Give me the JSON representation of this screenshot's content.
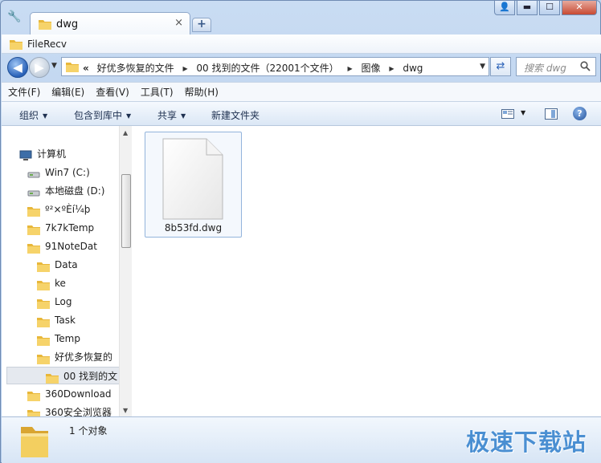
{
  "window": {
    "tab_title": "dwg",
    "tab_close": "×",
    "new_tab": "+",
    "controls": {
      "user": "👤",
      "minimize": "▬",
      "maximize": "☐",
      "close": "✕"
    }
  },
  "favorites": {
    "label": "FileRecv"
  },
  "nav": {
    "back": "◀",
    "forward": "▶",
    "breadcrumbs": [
      "好优多恢复的文件",
      "00 找到的文件（22001个文件）",
      "图像",
      "dwg"
    ],
    "search_placeholder": "搜索 dwg"
  },
  "menu": [
    "文件(F)",
    "编辑(E)",
    "查看(V)",
    "工具(T)",
    "帮助(H)"
  ],
  "commands": {
    "organize": "组织",
    "include_in_library": "包含到库中",
    "share": "共享",
    "new_folder": "新建文件夹",
    "help": "?"
  },
  "tree": [
    {
      "label": "计算机",
      "indent": 0,
      "icon": "computer-icon"
    },
    {
      "label": "Win7 (C:)",
      "indent": 1,
      "icon": "drive-icon"
    },
    {
      "label": "本地磁盘 (D:)",
      "indent": 1,
      "icon": "drive-icon"
    },
    {
      "label": "º²×ºÈí¼þ",
      "indent": 2,
      "icon": "folder-icon"
    },
    {
      "label": "7k7kTemp",
      "indent": 2,
      "icon": "folder-icon"
    },
    {
      "label": "91NoteDat",
      "indent": 2,
      "icon": "folder-icon"
    },
    {
      "label": "Data",
      "indent": 3,
      "icon": "folder-icon"
    },
    {
      "label": "ke",
      "indent": 3,
      "icon": "folder-icon"
    },
    {
      "label": "Log",
      "indent": 3,
      "icon": "folder-icon"
    },
    {
      "label": "Task",
      "indent": 3,
      "icon": "folder-icon"
    },
    {
      "label": "Temp",
      "indent": 3,
      "icon": "folder-icon"
    },
    {
      "label": "好优多恢复的",
      "indent": 3,
      "icon": "folder-icon"
    },
    {
      "label": "00 找到的文",
      "indent": 4,
      "icon": "folder-icon",
      "selected": true
    },
    {
      "label": "360Download",
      "indent": 2,
      "icon": "folder-icon"
    },
    {
      "label": "360安全浏览器",
      "indent": 2,
      "icon": "folder-icon"
    }
  ],
  "files": [
    {
      "name": "8b53fd.dwg"
    }
  ],
  "details": {
    "count": "1 个对象"
  },
  "watermark": "极速下载站",
  "colors": {
    "accent": "#4a8fd2",
    "folder": "#f2c54b",
    "selection": "#93b4dc"
  }
}
